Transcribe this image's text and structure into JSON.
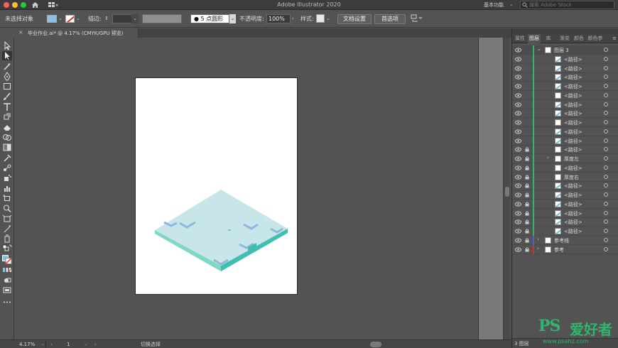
{
  "app": {
    "title": "Adobe Illustrator 2020",
    "workspace": "基本功能",
    "search_placeholder": "搜索 Adobe Stock"
  },
  "control_bar": {
    "selection_label": "未选择对象",
    "stroke_label": "描边:",
    "brush_label": "5 点圆形",
    "opacity_label": "不透明度:",
    "opacity_value": "100%",
    "style_label": "样式:",
    "doc_setup_button": "文档设置",
    "preferences_button": "首选项",
    "fill_color": "#8fc0df"
  },
  "document_tab": {
    "label": "毕业作业.ai* @ 4.17% (CMYK/GPU 预览)"
  },
  "status_bar": {
    "zoom": "4.17%",
    "page": "1",
    "tool_status": "切换选择"
  },
  "layers_panel": {
    "tabs": [
      "属性",
      "图层",
      "库",
      "渐变",
      "颜色",
      "颜色参"
    ],
    "active_tab": "图层",
    "layers": [
      {
        "name": "图层 3",
        "level": 0,
        "expanded": true,
        "locked": false,
        "color": "#2fb56d",
        "thumb": "layer"
      },
      {
        "name": "<路径>",
        "level": 1,
        "locked": false,
        "color": "#2fb56d",
        "thumb": "path"
      },
      {
        "name": "<路径>",
        "level": 1,
        "locked": false,
        "color": "#2fb56d",
        "thumb": "path"
      },
      {
        "name": "<路径>",
        "level": 1,
        "locked": false,
        "color": "#2fb56d",
        "thumb": "path"
      },
      {
        "name": "<路径>",
        "level": 1,
        "locked": false,
        "color": "#2fb56d",
        "thumb": "path"
      },
      {
        "name": "<路径>",
        "level": 1,
        "locked": false,
        "color": "#2fb56d",
        "thumb": "blank"
      },
      {
        "name": "<路径>",
        "level": 1,
        "locked": false,
        "color": "#2fb56d",
        "thumb": "path"
      },
      {
        "name": "<路径>",
        "level": 1,
        "locked": false,
        "color": "#2fb56d",
        "thumb": "path"
      },
      {
        "name": "<路径>",
        "level": 1,
        "locked": false,
        "color": "#2fb56d",
        "thumb": "blank"
      },
      {
        "name": "<路径>",
        "level": 1,
        "locked": false,
        "color": "#2fb56d",
        "thumb": "path"
      },
      {
        "name": "<路径>",
        "level": 1,
        "locked": false,
        "color": "#2fb56d",
        "thumb": "path"
      },
      {
        "name": "<路径>",
        "level": 1,
        "locked": true,
        "color": "#2fb56d",
        "thumb": "blank"
      },
      {
        "name": "厚度左",
        "level": 1,
        "locked": true,
        "color": "#2fb56d",
        "thumb": "blank",
        "group": true
      },
      {
        "name": "<路径>",
        "level": 1,
        "locked": true,
        "color": "#2fb56d",
        "thumb": "blank"
      },
      {
        "name": "厚度右",
        "level": 1,
        "locked": true,
        "color": "#2fb56d",
        "thumb": "blank"
      },
      {
        "name": "<路径>",
        "level": 1,
        "locked": true,
        "color": "#2fb56d",
        "thumb": "path"
      },
      {
        "name": "<路径>",
        "level": 1,
        "locked": true,
        "color": "#2fb56d",
        "thumb": "path"
      },
      {
        "name": "<路径>",
        "level": 1,
        "locked": true,
        "color": "#2fb56d",
        "thumb": "path"
      },
      {
        "name": "<路径>",
        "level": 1,
        "locked": true,
        "color": "#2fb56d",
        "thumb": "path"
      },
      {
        "name": "<路径>",
        "level": 1,
        "locked": true,
        "color": "#2fb56d",
        "thumb": "path"
      },
      {
        "name": "<路径>",
        "level": 1,
        "locked": true,
        "color": "#2fb56d",
        "thumb": "path"
      },
      {
        "name": "参考线",
        "level": 0,
        "expanded": false,
        "locked": true,
        "color": "#4a5fd0",
        "thumb": "blank"
      },
      {
        "name": "参考",
        "level": 0,
        "expanded": false,
        "locked": true,
        "color": "#d03030",
        "thumb": "doc"
      }
    ],
    "layer_count": "3 图层"
  },
  "watermark": {
    "logo": "PS",
    "logo_cn": "爱好者",
    "url": "www.psahz.com"
  },
  "artwork": {
    "top_color": "#c8e6ea",
    "side_left_color": "#7fd8c4",
    "side_right_color": "#3fbfb0",
    "notch_color": "#8fb7de"
  }
}
